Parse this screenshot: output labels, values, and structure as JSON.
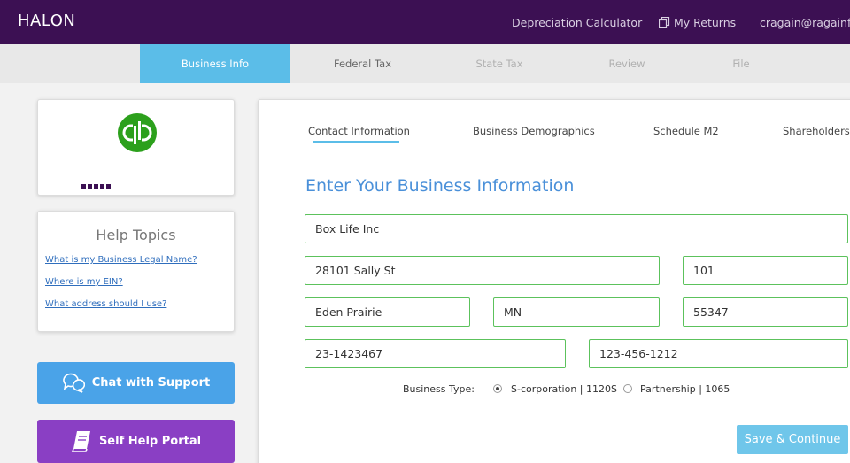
{
  "header": {
    "brand": "HALON",
    "nav": {
      "depreciation": "Depreciation Calculator",
      "returns": "My Returns",
      "user": "cragain@ragainfi"
    }
  },
  "steps": [
    "Business Info",
    "Federal Tax",
    "State Tax",
    "Review",
    "File"
  ],
  "sidebar": {
    "logo_dots": "•••••",
    "help": {
      "title": "Help Topics",
      "links": [
        "What is my Business Legal Name?",
        "Where is my EIN?",
        "What address should I use?"
      ]
    },
    "chat_label": "Chat with Support",
    "selfhelp_label": "Self Help Portal"
  },
  "subtabs": [
    "Contact Information",
    "Business Demographics",
    "Schedule M2",
    "Shareholders"
  ],
  "form": {
    "title": "Enter Your Business Information",
    "business_name": "Box Life Inc",
    "street": "28101 Sally St",
    "suite": "101",
    "city": "Eden Prairie",
    "state": "MN",
    "zip": "55347",
    "ein": "23-1423467",
    "phone": "123-456-1212",
    "business_type_label": "Business Type:",
    "options": [
      "S-corporation | 1120S",
      "Partnership | 1065"
    ],
    "selected_option": "S-corporation | 1120S",
    "save_label": "Save & Continue"
  },
  "colors": {
    "header_bg": "#3c1053",
    "active_step": "#5bbde8",
    "field_border": "#5cc25c",
    "chat_button": "#4aa3e8",
    "selfhelp_button": "#8a3fc4",
    "quickbooks_green": "#2ca01c"
  }
}
